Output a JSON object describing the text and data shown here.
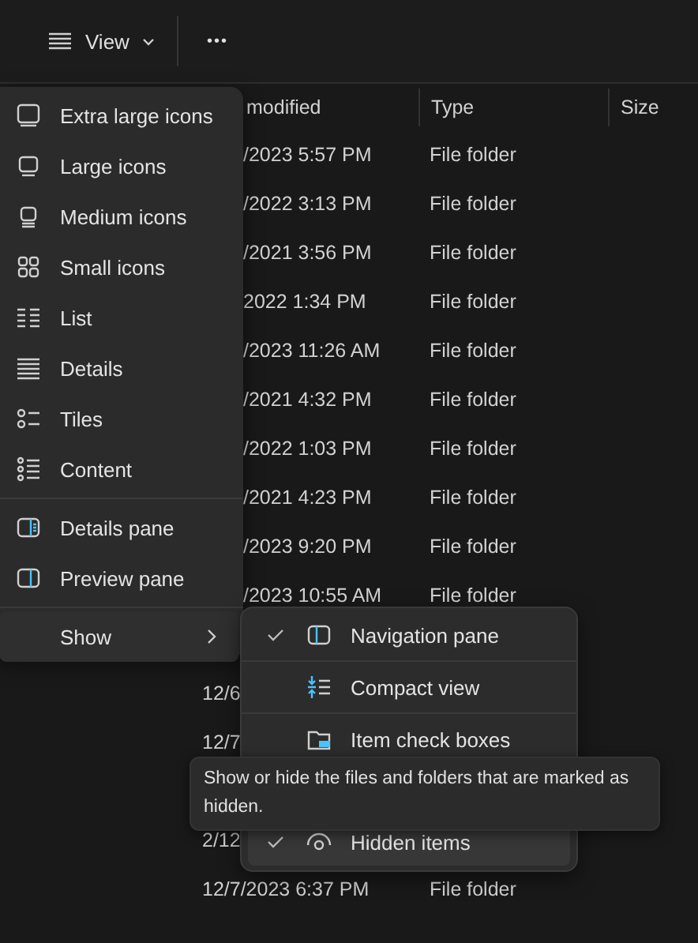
{
  "toolbar": {
    "view_button": "View",
    "more_button": "•••"
  },
  "file_list": {
    "columns": [
      "modified",
      "Type",
      "Size"
    ],
    "rows": [
      {
        "date_modified": "/2023 5:57 PM",
        "type": "File folder"
      },
      {
        "date_modified": "/2022 3:13 PM",
        "type": "File folder"
      },
      {
        "date_modified": "/2021 3:56 PM",
        "type": "File folder"
      },
      {
        "date_modified": "2022 1:34 PM",
        "type": "File folder"
      },
      {
        "date_modified": "/2023 11:26 AM",
        "type": "File folder"
      },
      {
        "date_modified": "/2021 4:32 PM",
        "type": "File folder"
      },
      {
        "date_modified": "/2022 1:03 PM",
        "type": "File folder"
      },
      {
        "date_modified": "/2021 4:23 PM",
        "type": "File folder"
      },
      {
        "date_modified": "/2023 9:20 PM",
        "type": "File folder"
      },
      {
        "date_modified": "/2023 10:55 AM",
        "type": "File folder"
      },
      {},
      {
        "date_modified": "12/6"
      },
      {
        "date_modified": "12/7"
      },
      {},
      {
        "date_modified": "2/12"
      },
      {
        "date_modified": "12/7/2023 6:37 PM",
        "type": "File folder"
      }
    ]
  },
  "view_menu": {
    "groups": [
      [
        {
          "label": "Extra large icons"
        },
        {
          "label": "Large icons"
        },
        {
          "label": "Medium icons"
        },
        {
          "label": "Small icons"
        },
        {
          "label": "List"
        },
        {
          "label": "Details"
        },
        {
          "label": "Tiles"
        },
        {
          "label": "Content"
        }
      ],
      [
        {
          "label": "Details pane"
        },
        {
          "label": "Preview pane"
        }
      ],
      [
        {
          "label": "Show",
          "expanded": true
        }
      ]
    ]
  },
  "show_menu": {
    "items": [
      {
        "label": "Navigation pane",
        "checked": true,
        "highlighted": false
      },
      {
        "label": "Compact view",
        "checked": false,
        "highlighted": false
      },
      {
        "label": "Item check boxes",
        "checked": false,
        "highlighted": false
      },
      {
        "label": "Hidden items",
        "checked": true,
        "highlighted": true
      }
    ]
  },
  "tooltip": "Show or hide the files and folders that are marked as hidden."
}
